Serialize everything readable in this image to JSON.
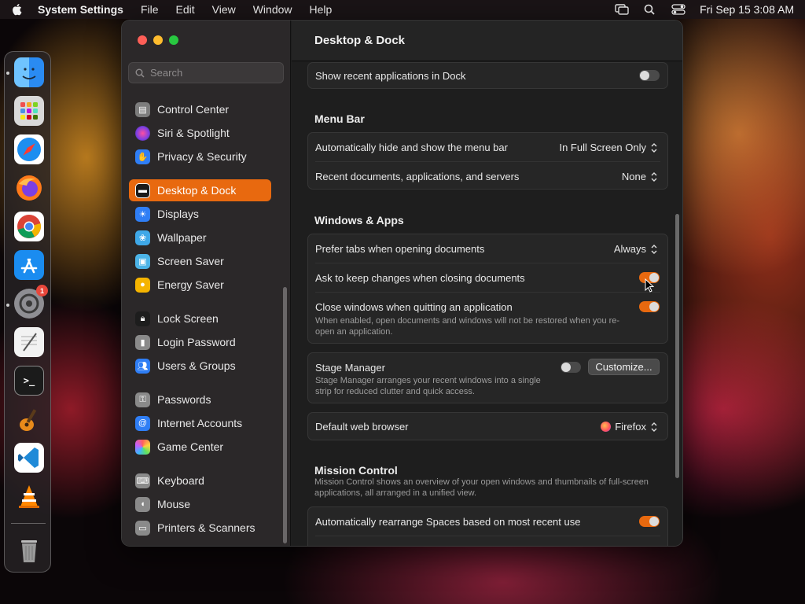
{
  "menubar": {
    "app_name": "System Settings",
    "items": [
      "File",
      "Edit",
      "View",
      "Window",
      "Help"
    ],
    "clock": "Fri Sep 15  3:08 AM",
    "icons": [
      "apple-icon",
      "screen-mirroring-icon",
      "spotlight-search-icon",
      "control-center-icon"
    ]
  },
  "dock": {
    "apps": [
      {
        "name": "Finder",
        "icon": "finder-icon",
        "color": "#2a8bf2"
      },
      {
        "name": "Launchpad",
        "icon": "launchpad-icon",
        "color": "#c8c8c8"
      },
      {
        "name": "Safari",
        "icon": "safari-icon",
        "color": "#1d8ef0"
      },
      {
        "name": "Firefox",
        "icon": "firefox-icon",
        "color": "#ff6a1f"
      },
      {
        "name": "Chrome",
        "icon": "chrome-icon",
        "color": "#ffffff"
      },
      {
        "name": "App Store",
        "icon": "app-store-icon",
        "color": "#1a8cf0"
      },
      {
        "name": "System Settings",
        "icon": "system-settings-icon",
        "color": "#8e8e93",
        "badge": "1"
      },
      {
        "name": "TextEdit",
        "icon": "textedit-icon",
        "color": "#f2f2f2"
      },
      {
        "name": "Terminal",
        "icon": "terminal-icon",
        "color": "#1b1b1b",
        "glyph": ">_"
      },
      {
        "name": "GarageBand",
        "icon": "garageband-icon",
        "color": "#5a3a1a"
      },
      {
        "name": "VS Code",
        "icon": "vscode-icon",
        "color": "#1f8ad8"
      },
      {
        "name": "VLC",
        "icon": "vlc-icon",
        "color": "#ff8800"
      },
      {
        "name": "Trash",
        "icon": "trash-icon",
        "color": "#7a7a7a"
      }
    ]
  },
  "sidebar": {
    "search_placeholder": "Search",
    "items": [
      {
        "label": "Control Center",
        "icon": "control-center-icon",
        "color": "#7d7d7d"
      },
      {
        "label": "Siri & Spotlight",
        "icon": "siri-icon",
        "color": "#b23ad1"
      },
      {
        "label": "Privacy & Security",
        "icon": "hand-icon",
        "color": "#2f7ef5"
      },
      {
        "label": "Desktop & Dock",
        "icon": "dock-icon",
        "color": "#202020"
      },
      {
        "label": "Displays",
        "icon": "sun-icon",
        "color": "#2f7ef5"
      },
      {
        "label": "Wallpaper",
        "icon": "flower-icon",
        "color": "#3fa8e8"
      },
      {
        "label": "Screen Saver",
        "icon": "screensaver-icon",
        "color": "#4cb4e8"
      },
      {
        "label": "Energy Saver",
        "icon": "bulb-icon",
        "color": "#f5b400"
      },
      {
        "label": "Lock Screen",
        "icon": "lock-icon",
        "color": "#1d1d1d"
      },
      {
        "label": "Login Password",
        "icon": "key-lock-icon",
        "color": "#8a8a8a"
      },
      {
        "label": "Users & Groups",
        "icon": "users-icon",
        "color": "#2f7ef5"
      },
      {
        "label": "Passwords",
        "icon": "key-icon",
        "color": "#8a8a8a"
      },
      {
        "label": "Internet Accounts",
        "icon": "at-icon",
        "color": "#2f7ef5"
      },
      {
        "label": "Game Center",
        "icon": "game-center-icon",
        "color": "#e0e0e0"
      },
      {
        "label": "Keyboard",
        "icon": "keyboard-icon",
        "color": "#8a8a8a"
      },
      {
        "label": "Mouse",
        "icon": "mouse-icon",
        "color": "#8a8a8a"
      },
      {
        "label": "Printers & Scanners",
        "icon": "printer-icon",
        "color": "#8a8a8a"
      }
    ],
    "active_index": 3
  },
  "main": {
    "title": "Desktop & Dock",
    "show_recent": {
      "label": "Show recent applications in Dock",
      "on": false
    },
    "menu_bar": {
      "title": "Menu Bar",
      "auto_hide": {
        "label": "Automatically hide and show the menu bar",
        "value": "In Full Screen Only"
      },
      "recent_docs": {
        "label": "Recent documents, applications, and servers",
        "value": "None"
      }
    },
    "windows_apps": {
      "title": "Windows & Apps",
      "prefer_tabs": {
        "label": "Prefer tabs when opening documents",
        "value": "Always"
      },
      "ask_keep": {
        "label": "Ask to keep changes when closing documents",
        "on": true
      },
      "close_windows": {
        "label": "Close windows when quitting an application",
        "desc": "When enabled, open documents and windows will not be restored when you re-open an application.",
        "on": true
      }
    },
    "stage_manager": {
      "label": "Stage Manager",
      "desc": "Stage Manager arranges your recent windows into a single strip for reduced clutter and quick access.",
      "on": false,
      "button": "Customize..."
    },
    "web_browser": {
      "label": "Default web browser",
      "value": "Firefox"
    },
    "mission_control": {
      "title": "Mission Control",
      "desc": "Mission Control shows an overview of your open windows and thumbnails of full-screen applications, all arranged in a unified view.",
      "auto_rearrange": {
        "label": "Automatically rearrange Spaces based on most recent use",
        "on": true
      }
    }
  },
  "colors": {
    "accent": "#e8690f"
  }
}
